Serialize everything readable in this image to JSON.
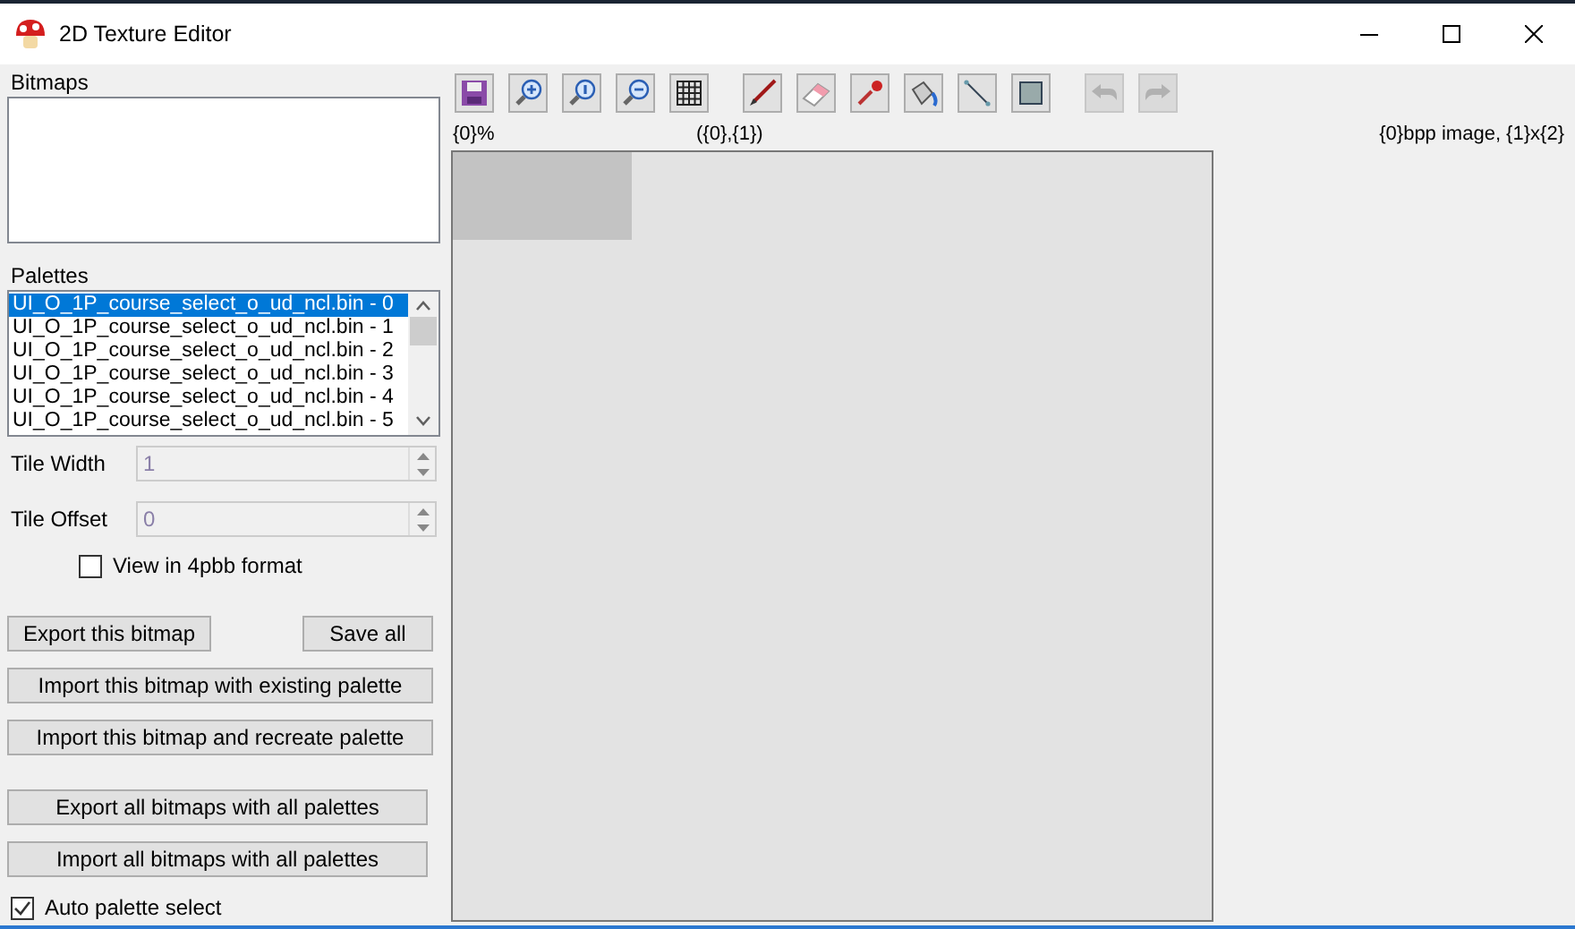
{
  "window": {
    "title": "2D Texture Editor"
  },
  "bitmaps": {
    "label": "Bitmaps"
  },
  "palettes": {
    "label": "Palettes",
    "items": [
      {
        "text": "UI_O_1P_course_select_o_ud_ncl.bin - 0",
        "selected": true
      },
      {
        "text": "UI_O_1P_course_select_o_ud_ncl.bin - 1",
        "selected": false
      },
      {
        "text": "UI_O_1P_course_select_o_ud_ncl.bin - 2",
        "selected": false
      },
      {
        "text": "UI_O_1P_course_select_o_ud_ncl.bin - 3",
        "selected": false
      },
      {
        "text": "UI_O_1P_course_select_o_ud_ncl.bin - 4",
        "selected": false
      },
      {
        "text": "UI_O_1P_course_select_o_ud_ncl.bin - 5",
        "selected": false
      }
    ]
  },
  "fields": [
    {
      "label": "Tile Width",
      "value": "1",
      "disabled": true
    },
    {
      "label": "Tile Offset",
      "value": "0",
      "disabled": true
    }
  ],
  "view_4bpp": {
    "label": "View in 4pbb format",
    "checked": false
  },
  "buttons": [
    {
      "label": "Export this bitmap",
      "kind": "half"
    },
    {
      "label": "Save all",
      "kind": "half"
    },
    {
      "label": "Import this bitmap with existing palette",
      "kind": "full"
    },
    {
      "label": "Import this bitmap and recreate palette",
      "kind": "full"
    },
    {
      "label": "Export all bitmaps with all palettes",
      "kind": "full"
    },
    {
      "label": "Import all bitmaps with all palettes",
      "kind": "full"
    }
  ],
  "auto_palette": {
    "label": "Auto palette select",
    "checked": true
  },
  "toolbar": [
    {
      "kind": "save",
      "disabled": false
    },
    {
      "kind": "zoom-in",
      "disabled": false
    },
    {
      "kind": "zoom-reset",
      "disabled": false
    },
    {
      "kind": "zoom-out",
      "disabled": false
    },
    {
      "kind": "grid",
      "disabled": false
    },
    {
      "kind": "brush",
      "disabled": false
    },
    {
      "kind": "eraser",
      "disabled": false
    },
    {
      "kind": "dropper",
      "disabled": false
    },
    {
      "kind": "bucket",
      "disabled": false
    },
    {
      "kind": "line",
      "disabled": false
    },
    {
      "kind": "rect",
      "disabled": false
    },
    {
      "kind": "undo",
      "disabled": true
    },
    {
      "kind": "redo",
      "disabled": true
    }
  ],
  "status": {
    "zoom": "{0}%",
    "position": "({0},{1})",
    "image_info": "{0}bpp image, {1}x{2}"
  }
}
